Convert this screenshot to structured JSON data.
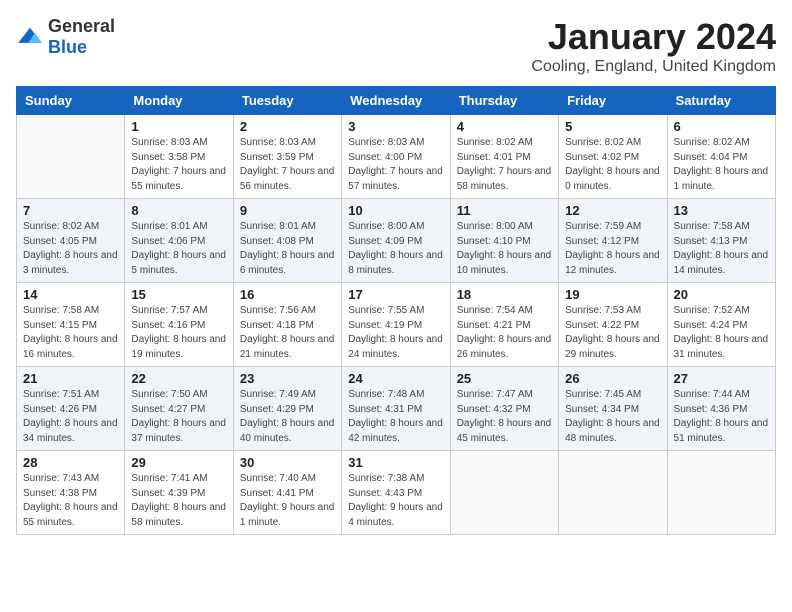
{
  "header": {
    "logo_general": "General",
    "logo_blue": "Blue",
    "title": "January 2024",
    "location": "Cooling, England, United Kingdom"
  },
  "weekdays": [
    "Sunday",
    "Monday",
    "Tuesday",
    "Wednesday",
    "Thursday",
    "Friday",
    "Saturday"
  ],
  "weeks": [
    [
      {
        "day": "",
        "sunrise": "",
        "sunset": "",
        "daylight": ""
      },
      {
        "day": "1",
        "sunrise": "Sunrise: 8:03 AM",
        "sunset": "Sunset: 3:58 PM",
        "daylight": "Daylight: 7 hours and 55 minutes."
      },
      {
        "day": "2",
        "sunrise": "Sunrise: 8:03 AM",
        "sunset": "Sunset: 3:59 PM",
        "daylight": "Daylight: 7 hours and 56 minutes."
      },
      {
        "day": "3",
        "sunrise": "Sunrise: 8:03 AM",
        "sunset": "Sunset: 4:00 PM",
        "daylight": "Daylight: 7 hours and 57 minutes."
      },
      {
        "day": "4",
        "sunrise": "Sunrise: 8:02 AM",
        "sunset": "Sunset: 4:01 PM",
        "daylight": "Daylight: 7 hours and 58 minutes."
      },
      {
        "day": "5",
        "sunrise": "Sunrise: 8:02 AM",
        "sunset": "Sunset: 4:02 PM",
        "daylight": "Daylight: 8 hours and 0 minutes."
      },
      {
        "day": "6",
        "sunrise": "Sunrise: 8:02 AM",
        "sunset": "Sunset: 4:04 PM",
        "daylight": "Daylight: 8 hours and 1 minute."
      }
    ],
    [
      {
        "day": "7",
        "sunrise": "Sunrise: 8:02 AM",
        "sunset": "Sunset: 4:05 PM",
        "daylight": "Daylight: 8 hours and 3 minutes."
      },
      {
        "day": "8",
        "sunrise": "Sunrise: 8:01 AM",
        "sunset": "Sunset: 4:06 PM",
        "daylight": "Daylight: 8 hours and 5 minutes."
      },
      {
        "day": "9",
        "sunrise": "Sunrise: 8:01 AM",
        "sunset": "Sunset: 4:08 PM",
        "daylight": "Daylight: 8 hours and 6 minutes."
      },
      {
        "day": "10",
        "sunrise": "Sunrise: 8:00 AM",
        "sunset": "Sunset: 4:09 PM",
        "daylight": "Daylight: 8 hours and 8 minutes."
      },
      {
        "day": "11",
        "sunrise": "Sunrise: 8:00 AM",
        "sunset": "Sunset: 4:10 PM",
        "daylight": "Daylight: 8 hours and 10 minutes."
      },
      {
        "day": "12",
        "sunrise": "Sunrise: 7:59 AM",
        "sunset": "Sunset: 4:12 PM",
        "daylight": "Daylight: 8 hours and 12 minutes."
      },
      {
        "day": "13",
        "sunrise": "Sunrise: 7:58 AM",
        "sunset": "Sunset: 4:13 PM",
        "daylight": "Daylight: 8 hours and 14 minutes."
      }
    ],
    [
      {
        "day": "14",
        "sunrise": "Sunrise: 7:58 AM",
        "sunset": "Sunset: 4:15 PM",
        "daylight": "Daylight: 8 hours and 16 minutes."
      },
      {
        "day": "15",
        "sunrise": "Sunrise: 7:57 AM",
        "sunset": "Sunset: 4:16 PM",
        "daylight": "Daylight: 8 hours and 19 minutes."
      },
      {
        "day": "16",
        "sunrise": "Sunrise: 7:56 AM",
        "sunset": "Sunset: 4:18 PM",
        "daylight": "Daylight: 8 hours and 21 minutes."
      },
      {
        "day": "17",
        "sunrise": "Sunrise: 7:55 AM",
        "sunset": "Sunset: 4:19 PM",
        "daylight": "Daylight: 8 hours and 24 minutes."
      },
      {
        "day": "18",
        "sunrise": "Sunrise: 7:54 AM",
        "sunset": "Sunset: 4:21 PM",
        "daylight": "Daylight: 8 hours and 26 minutes."
      },
      {
        "day": "19",
        "sunrise": "Sunrise: 7:53 AM",
        "sunset": "Sunset: 4:22 PM",
        "daylight": "Daylight: 8 hours and 29 minutes."
      },
      {
        "day": "20",
        "sunrise": "Sunrise: 7:52 AM",
        "sunset": "Sunset: 4:24 PM",
        "daylight": "Daylight: 8 hours and 31 minutes."
      }
    ],
    [
      {
        "day": "21",
        "sunrise": "Sunrise: 7:51 AM",
        "sunset": "Sunset: 4:26 PM",
        "daylight": "Daylight: 8 hours and 34 minutes."
      },
      {
        "day": "22",
        "sunrise": "Sunrise: 7:50 AM",
        "sunset": "Sunset: 4:27 PM",
        "daylight": "Daylight: 8 hours and 37 minutes."
      },
      {
        "day": "23",
        "sunrise": "Sunrise: 7:49 AM",
        "sunset": "Sunset: 4:29 PM",
        "daylight": "Daylight: 8 hours and 40 minutes."
      },
      {
        "day": "24",
        "sunrise": "Sunrise: 7:48 AM",
        "sunset": "Sunset: 4:31 PM",
        "daylight": "Daylight: 8 hours and 42 minutes."
      },
      {
        "day": "25",
        "sunrise": "Sunrise: 7:47 AM",
        "sunset": "Sunset: 4:32 PM",
        "daylight": "Daylight: 8 hours and 45 minutes."
      },
      {
        "day": "26",
        "sunrise": "Sunrise: 7:45 AM",
        "sunset": "Sunset: 4:34 PM",
        "daylight": "Daylight: 8 hours and 48 minutes."
      },
      {
        "day": "27",
        "sunrise": "Sunrise: 7:44 AM",
        "sunset": "Sunset: 4:36 PM",
        "daylight": "Daylight: 8 hours and 51 minutes."
      }
    ],
    [
      {
        "day": "28",
        "sunrise": "Sunrise: 7:43 AM",
        "sunset": "Sunset: 4:38 PM",
        "daylight": "Daylight: 8 hours and 55 minutes."
      },
      {
        "day": "29",
        "sunrise": "Sunrise: 7:41 AM",
        "sunset": "Sunset: 4:39 PM",
        "daylight": "Daylight: 8 hours and 58 minutes."
      },
      {
        "day": "30",
        "sunrise": "Sunrise: 7:40 AM",
        "sunset": "Sunset: 4:41 PM",
        "daylight": "Daylight: 9 hours and 1 minute."
      },
      {
        "day": "31",
        "sunrise": "Sunrise: 7:38 AM",
        "sunset": "Sunset: 4:43 PM",
        "daylight": "Daylight: 9 hours and 4 minutes."
      },
      {
        "day": "",
        "sunrise": "",
        "sunset": "",
        "daylight": ""
      },
      {
        "day": "",
        "sunrise": "",
        "sunset": "",
        "daylight": ""
      },
      {
        "day": "",
        "sunrise": "",
        "sunset": "",
        "daylight": ""
      }
    ]
  ]
}
